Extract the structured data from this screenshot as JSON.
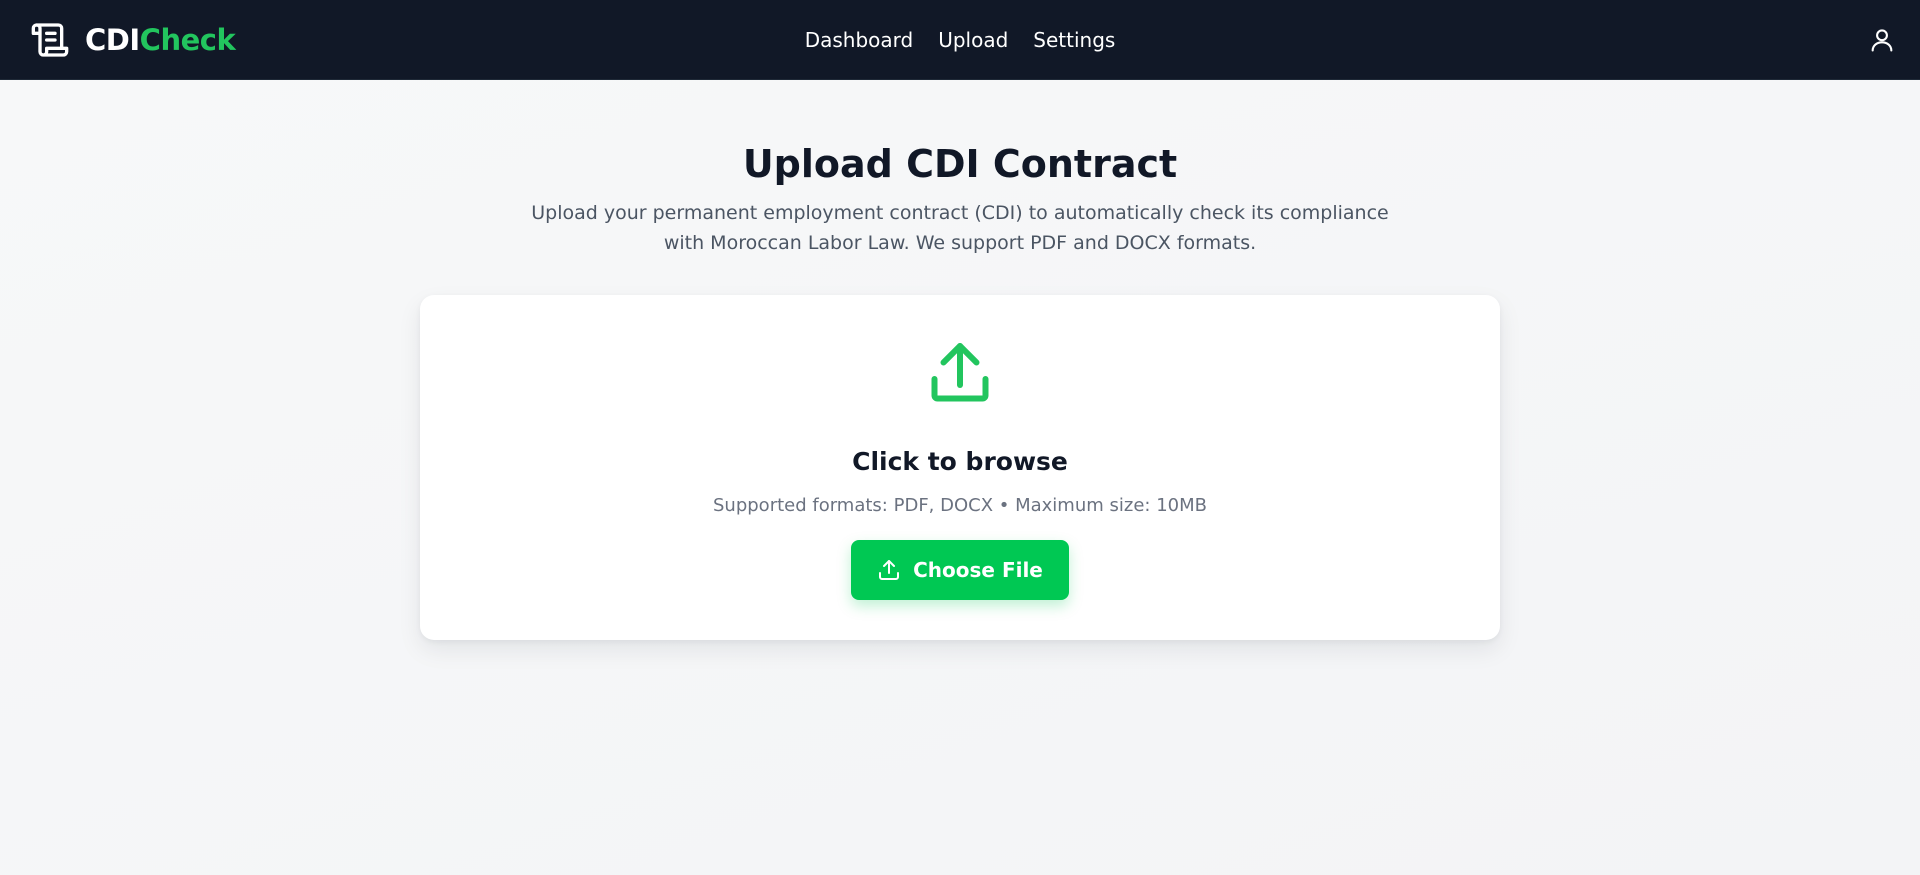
{
  "header": {
    "brand_part1": "CDI",
    "brand_part2": "Check",
    "brand_icon": "scroll-icon",
    "nav": [
      {
        "label": "Dashboard"
      },
      {
        "label": "Upload"
      },
      {
        "label": "Settings"
      }
    ],
    "user_icon": "user-icon"
  },
  "main": {
    "title": "Upload CDI Contract",
    "description": "Upload your permanent employment contract (CDI) to automatically check its compliance with Moroccan Labor Law. We support PDF and DOCX formats.",
    "upload_card": {
      "icon": "upload-icon",
      "browse_title": "Click to browse",
      "supported_text": "Supported formats: PDF, DOCX • Maximum size: 10MB",
      "button_label": "Choose File",
      "button_icon": "upload-icon"
    }
  },
  "colors": {
    "header_bg": "#111827",
    "accent": "#22c55e",
    "button": "#00c853",
    "page_bg": "#f5f6f8"
  }
}
